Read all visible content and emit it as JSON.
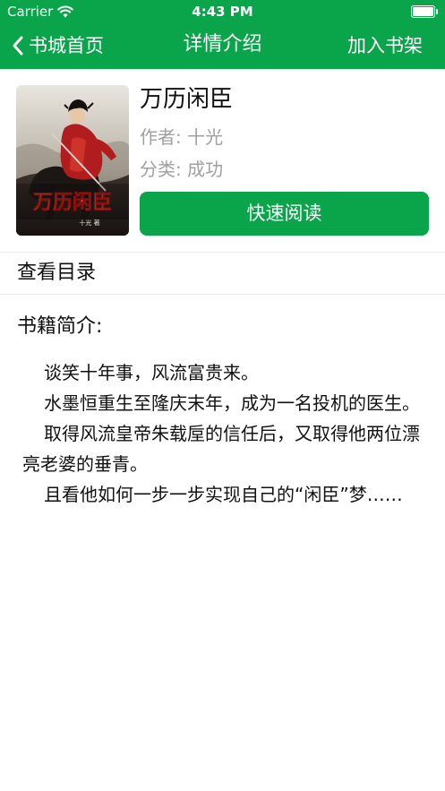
{
  "status_bar": {
    "carrier": "Carrier",
    "time": "4:43 PM"
  },
  "nav": {
    "back_label": "书城首页",
    "title": "详情介绍",
    "action_label": "加入书架"
  },
  "book": {
    "title": "万历闲臣",
    "author_label": "作者: 十光",
    "category_label": "分类: 成功",
    "cover_title": "万历闲臣",
    "cover_author": "十光 著",
    "read_button": "快速阅读"
  },
  "toc": {
    "label": "查看目录"
  },
  "intro": {
    "heading": "书籍简介:",
    "paragraphs": [
      "谈笑十年事，风流富贵来。",
      "水墨恒重生至隆庆末年，成为一名投机的医生。",
      "取得风流皇帝朱载垕的信任后，又取得他两位漂亮老婆的垂青。",
      "且看他如何一步一步实现自己的“闲臣”梦……"
    ]
  },
  "colors": {
    "accent": "#0aa44a",
    "text": "#111111",
    "muted": "#a0a0a0",
    "divider": "#ececec"
  },
  "icons": {
    "wifi": "wifi-icon",
    "battery": "battery-icon",
    "back": "chevron-left-icon"
  }
}
